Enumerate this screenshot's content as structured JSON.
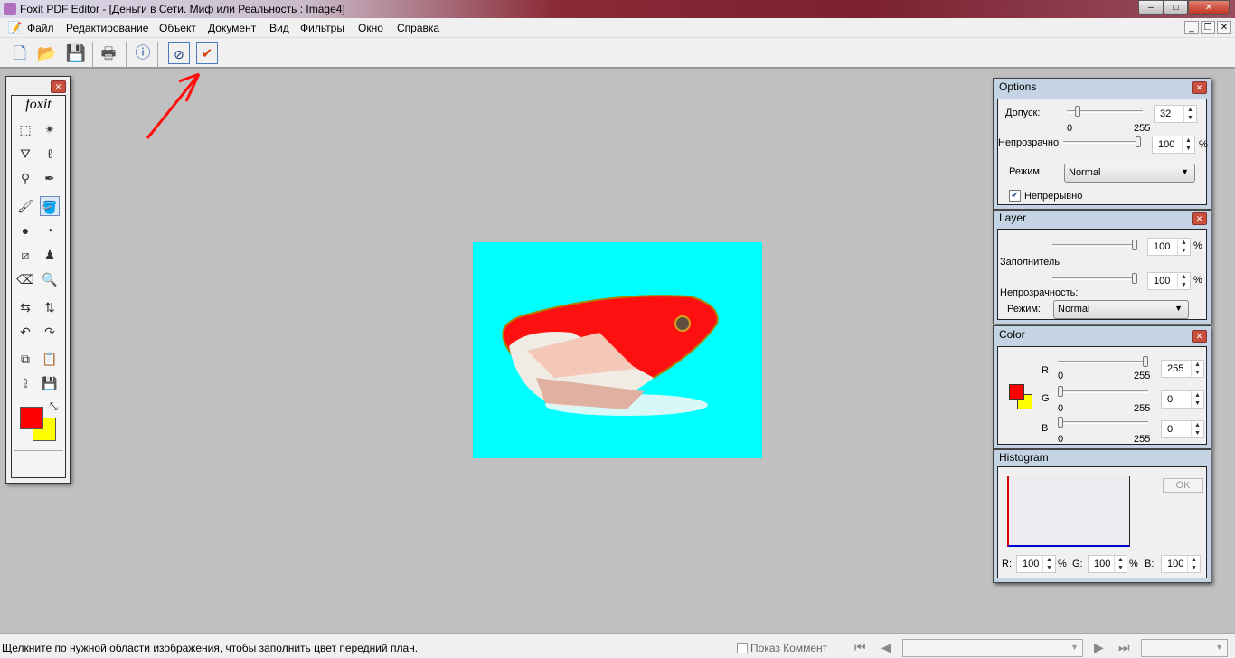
{
  "window": {
    "title": "Foxit PDF Editor - [Деньги в Сети. Миф или Реальность : Image4]",
    "minimize": "–",
    "maximize": "□",
    "close": "✕"
  },
  "menu": [
    "Файл",
    "Редактирование",
    "Объект",
    "Документ",
    "Вид",
    "Фильтры",
    "Окно",
    "Справка"
  ],
  "toolbar": {
    "icons": [
      "new-document-icon",
      "open-folder-icon",
      "save-icon",
      "print-icon",
      "info-icon",
      "cancel-icon",
      "apply-check-icon"
    ]
  },
  "toolbox": {
    "logo": "foxit",
    "foreground_color": "#ff0000",
    "background_color": "#ffff00"
  },
  "options": {
    "title": "Options",
    "tolerance_label": "Допуск:",
    "tolerance_value": "32",
    "tolerance_min": "0",
    "tolerance_max": "255",
    "opacity_label": "Непрозрачно",
    "opacity_value": "100",
    "percent": "%",
    "mode_label": "Режим",
    "mode_value": "Normal",
    "continuous_label": "Непрерывно",
    "continuous_checked": true
  },
  "layer": {
    "title": "Layer",
    "fill_value": "100",
    "fill_label": "Заполнитель:",
    "opacity_value": "100",
    "opacity_label": "Непрозрачность:",
    "mode_label": "Режим:",
    "mode_value": "Normal",
    "percent": "%"
  },
  "color": {
    "title": "Color",
    "r_label": "R",
    "g_label": "G",
    "b_label": "B",
    "r_value": "255",
    "g_value": "0",
    "b_value": "0",
    "min": "0",
    "max": "255"
  },
  "histogram": {
    "title": "Histogram",
    "ok_label": "OK",
    "r_label": "R:",
    "g_label": "G:",
    "b_label": "B:",
    "r_value": "100",
    "g_value": "100",
    "b_value": "100",
    "percent": "%"
  },
  "status": {
    "message": "Щелкните по нужной области изображения, чтобы заполнить цвет передний план.",
    "show_comments": "Показ Коммент"
  }
}
